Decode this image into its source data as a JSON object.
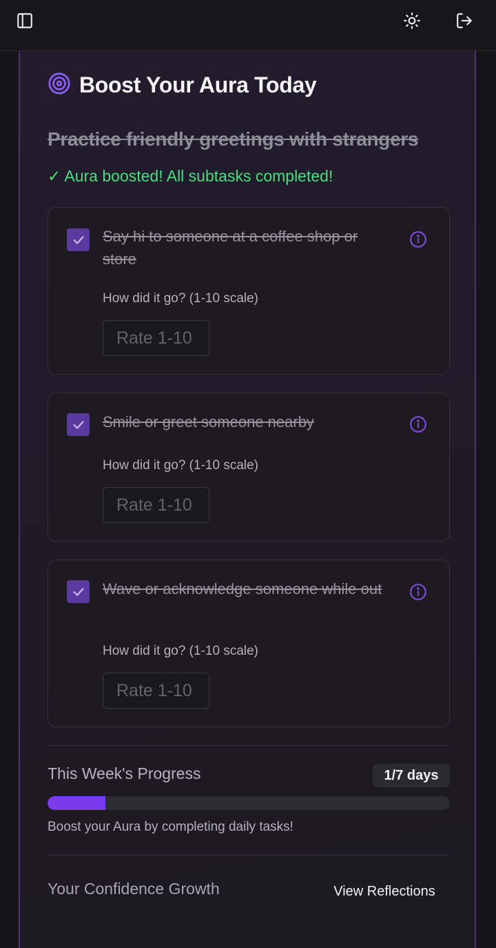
{
  "header": {
    "sidebar_icon": "sidebar-toggle-icon",
    "theme_icon": "sun-icon",
    "logout_icon": "logout-icon"
  },
  "card": {
    "title_icon": "target-icon",
    "title": "Boost Your Aura Today",
    "task_title": "Practice friendly greetings with strangers",
    "status": "✓ Aura boosted! All subtasks completed!"
  },
  "subtasks": [
    {
      "text": "Say hi to someone at a coffee shop or store",
      "checked": true,
      "question": "How did it go? (1-10 scale)",
      "placeholder": "Rate 1-10"
    },
    {
      "text": "Smile or greet someone nearby",
      "checked": true,
      "question": "How did it go? (1-10 scale)",
      "placeholder": "Rate 1-10"
    },
    {
      "text": "Wave or acknowledge someone while out",
      "checked": true,
      "question": "How did it go? (1-10 scale)",
      "placeholder": "Rate 1-10"
    }
  ],
  "progress": {
    "label": "This Week's Progress",
    "days": "1/7 days",
    "fraction": 0.143,
    "hint": "Boost your Aura by completing daily tasks!"
  },
  "growth": {
    "label": "Your Confidence Growth",
    "button": "View Reflections"
  },
  "colors": {
    "accent": "#7c3aed",
    "success": "#4ade80",
    "checkbox": "#5b3aa0"
  }
}
